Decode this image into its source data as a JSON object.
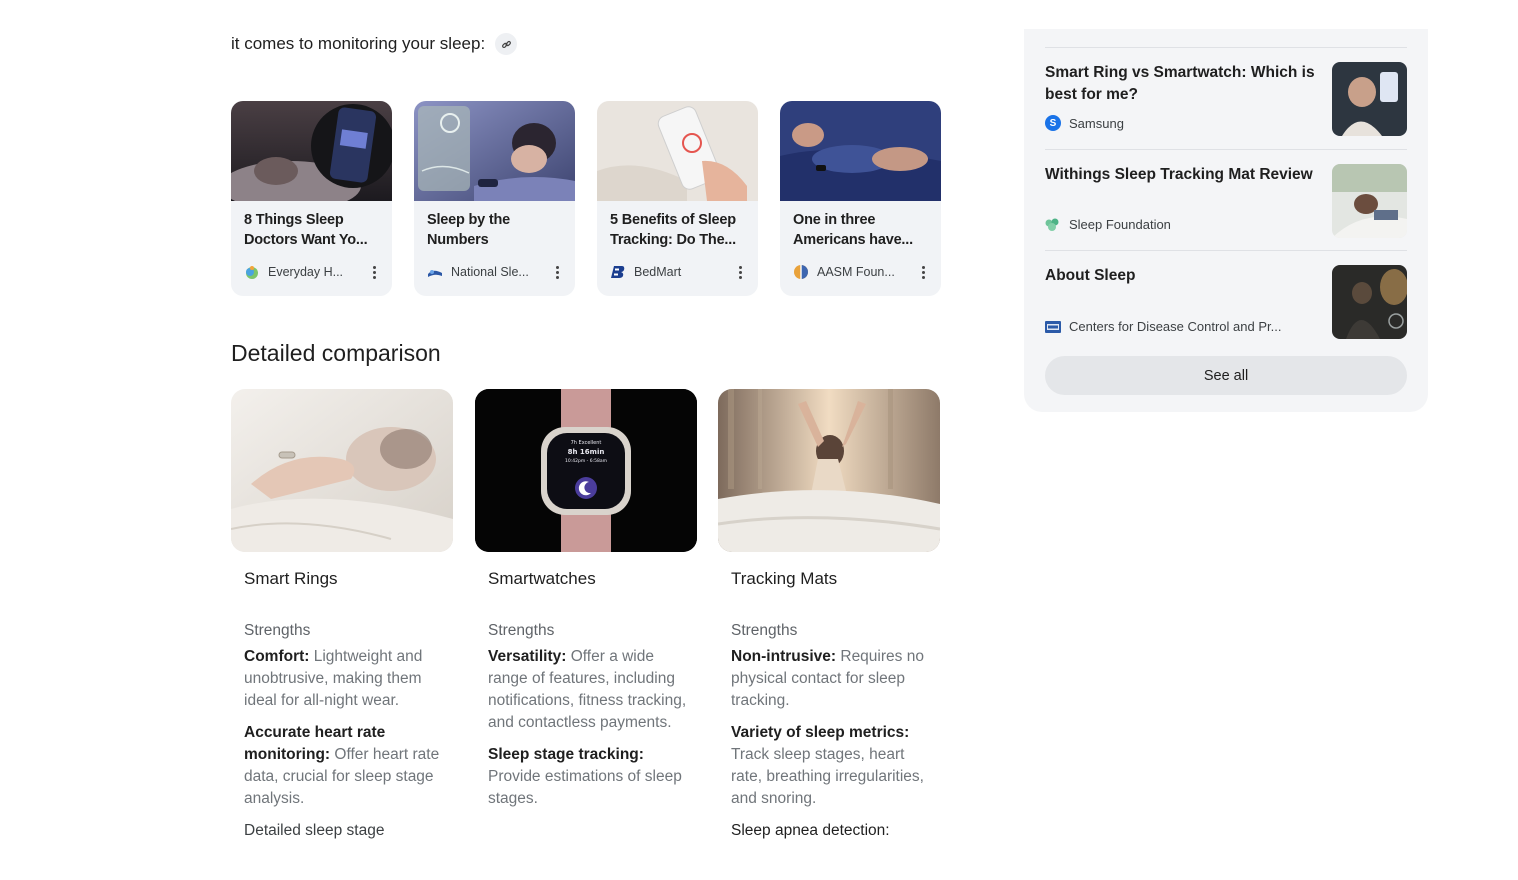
{
  "intro": {
    "text": "it comes to monitoring your sleep:",
    "link_icon": "link-icon"
  },
  "source_cards": [
    {
      "title": "8 Things Sleep Doctors Want Yo...",
      "source": "Everyday H...",
      "source_icon": "everyday-health-icon"
    },
    {
      "title": "Sleep by the Numbers",
      "source": "National Sle...",
      "source_icon": "national-sleep-icon"
    },
    {
      "title": "5 Benefits of Sleep Tracking: Do The...",
      "source": "BedMart",
      "source_icon": "bedmart-icon"
    },
    {
      "title": "One in three Americans have...",
      "source": "AASM Foun...",
      "source_icon": "aasm-icon"
    }
  ],
  "comparison": {
    "title": "Detailed comparison",
    "columns": [
      {
        "name": "Smart Rings",
        "strengths_label": "Strengths",
        "items": [
          {
            "bold": "Comfort:",
            "text": " Lightweight and unobtrusive, making them ideal for all-night wear."
          },
          {
            "bold": "Accurate heart rate monitoring:",
            "text": " Offer heart rate data, crucial for sleep stage analysis."
          }
        ],
        "trailing": "Detailed sleep stage"
      },
      {
        "name": "Smartwatches",
        "strengths_label": "Strengths",
        "items": [
          {
            "bold": "Versatility:",
            "text": " Offer a wide range of features, including notifications, fitness tracking, and contactless payments."
          },
          {
            "bold": "Sleep stage tracking:",
            "text": " Provide estimations of sleep stages."
          }
        ],
        "trailing": "",
        "watch_screen": {
          "line1": "7h Excellent",
          "line2": "8h 16min",
          "line3": "10:42pm - 6:58am"
        }
      },
      {
        "name": "Tracking Mats",
        "strengths_label": "Strengths",
        "items": [
          {
            "bold": "Non-intrusive:",
            "text": " Requires no physical contact for sleep tracking."
          },
          {
            "bold": "Variety of sleep metrics:",
            "text": " Track sleep stages, heart rate, breathing irregularities, and snoring."
          }
        ],
        "trailing": "Sleep apnea detection:"
      }
    ]
  },
  "side_panel": {
    "items": [
      {
        "title": "Smart Ring vs Smartwatch: Which is best for me?",
        "source": "Samsung",
        "source_icon": "samsung-icon",
        "source_letter": "S"
      },
      {
        "title": "Withings Sleep Tracking Mat Review",
        "source": "Sleep Foundation",
        "source_icon": "sleep-foundation-icon"
      },
      {
        "title": "About Sleep",
        "source": "Centers for Disease Control and Pr...",
        "source_icon": "cdc-icon"
      }
    ],
    "see_all_label": "See all"
  },
  "colors": {
    "card_bg": "#f1f3f6",
    "panel_bg": "#f4f5f7",
    "button_bg": "#e4e6e9",
    "samsung_blue": "#1a73e8"
  }
}
